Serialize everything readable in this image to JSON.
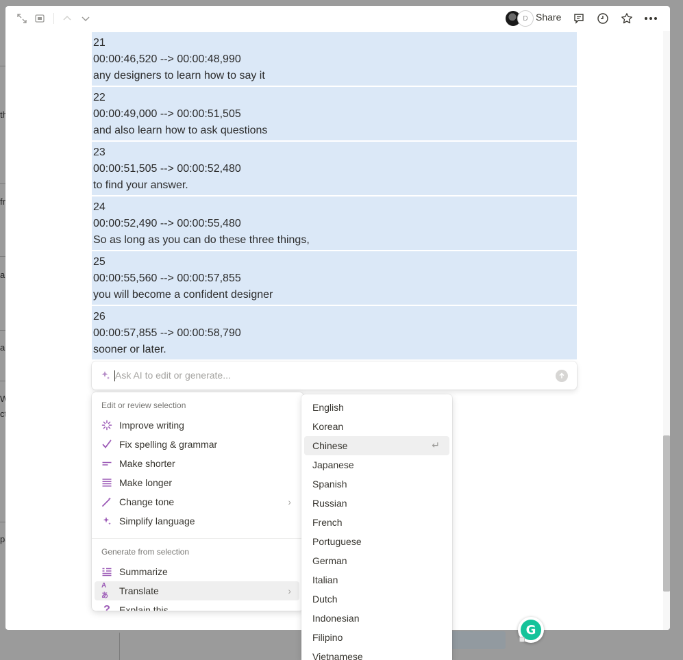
{
  "background": {
    "fragments": [
      "th",
      "fr",
      "a",
      "a",
      "W",
      "ct",
      "pa"
    ]
  },
  "topbar": {
    "share_label": "Share",
    "avatar_initial": "D"
  },
  "subtitles": [
    {
      "index": "21",
      "time": "00:00:46,520 --> 00:00:48,990",
      "text": "any designers to learn how to say it"
    },
    {
      "index": "22",
      "time": "00:00:49,000 --> 00:00:51,505",
      "text": "and also learn how to ask questions"
    },
    {
      "index": "23",
      "time": "00:00:51,505 --> 00:00:52,480",
      "text": "to find your answer."
    },
    {
      "index": "24",
      "time": "00:00:52,490 --> 00:00:55,480",
      "text": "So as long as you can do these three things,"
    },
    {
      "index": "25",
      "time": "00:00:55,560 --> 00:00:57,855",
      "text": "you will become a confident designer"
    },
    {
      "index": "26",
      "time": "00:00:57,855 --> 00:00:58,790",
      "text": "sooner or later."
    }
  ],
  "ai_input": {
    "placeholder": "Ask AI to edit or generate..."
  },
  "menu": {
    "section_edit": "Edit or review selection",
    "edit_items": [
      {
        "label": "Improve writing",
        "icon": "sparkle-burst-icon"
      },
      {
        "label": "Fix spelling & grammar",
        "icon": "checkmark-icon"
      },
      {
        "label": "Make shorter",
        "icon": "short-lines-icon"
      },
      {
        "label": "Make longer",
        "icon": "long-lines-icon"
      },
      {
        "label": "Change tone",
        "icon": "magic-wand-icon"
      },
      {
        "label": "Simplify language",
        "icon": "sparkles-icon"
      }
    ],
    "section_generate": "Generate from selection",
    "generate_items": [
      {
        "label": "Summarize",
        "icon": "summary-icon"
      },
      {
        "label": "Translate",
        "icon": "translate-icon"
      },
      {
        "label": "Explain this",
        "icon": "question-icon"
      }
    ]
  },
  "languages": {
    "selected": "Chinese",
    "items": [
      "English",
      "Korean",
      "Chinese",
      "Japanese",
      "Spanish",
      "Russian",
      "French",
      "Portuguese",
      "German",
      "Italian",
      "Dutch",
      "Indonesian",
      "Filipino",
      "Vietnamese"
    ]
  },
  "colors": {
    "selection_highlight": "#dbe8f7",
    "accent_purple": "#9b59b6",
    "grammarly_green": "#15c39a"
  }
}
